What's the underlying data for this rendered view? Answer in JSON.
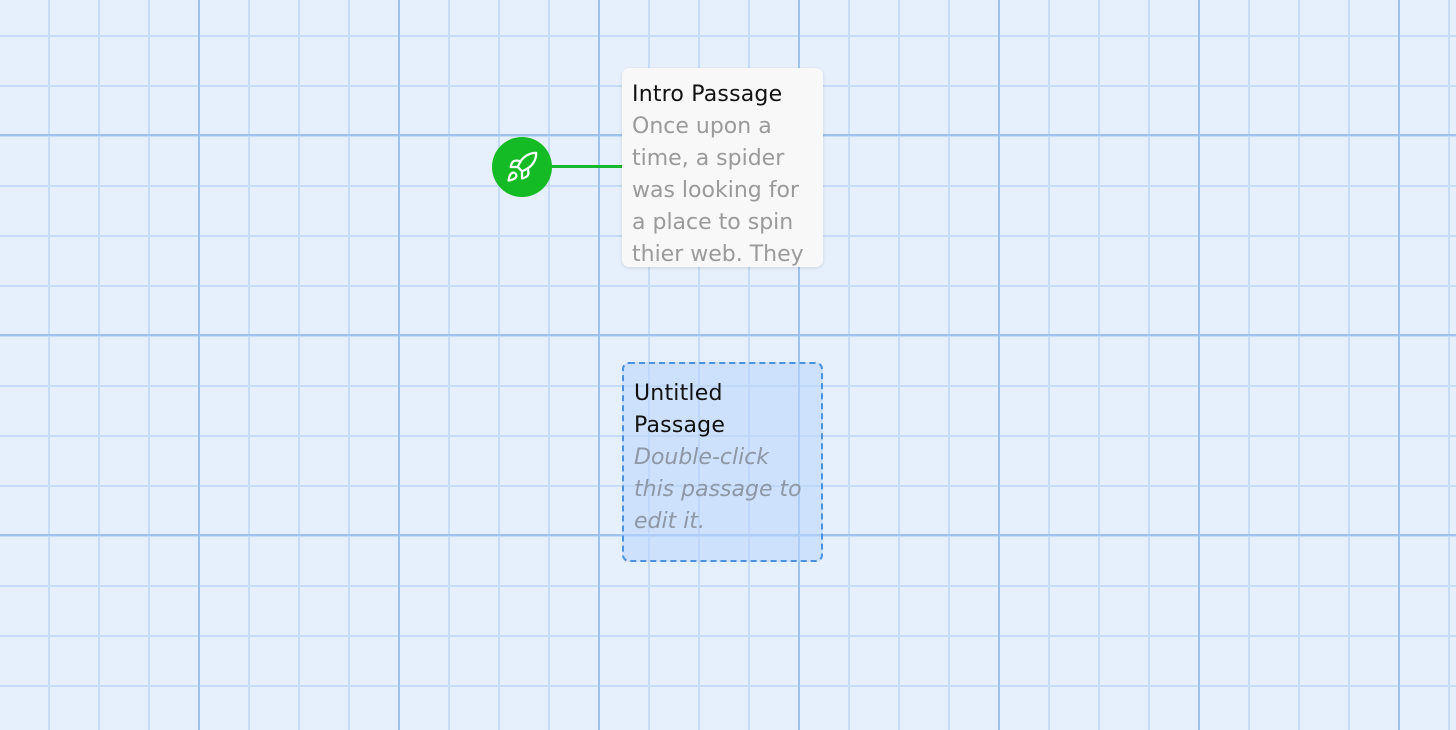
{
  "story_map": {
    "start_marker": {
      "icon": "rocket-icon",
      "color": "#14bb24"
    },
    "passages": [
      {
        "title": "Intro Passage",
        "excerpt": "Once upon a time, a spider was looking for a place to spin thier web. They",
        "selected": false
      },
      {
        "title": "Untitled Passage",
        "excerpt": "Double-click this passage to edit it.",
        "selected": true
      }
    ]
  }
}
